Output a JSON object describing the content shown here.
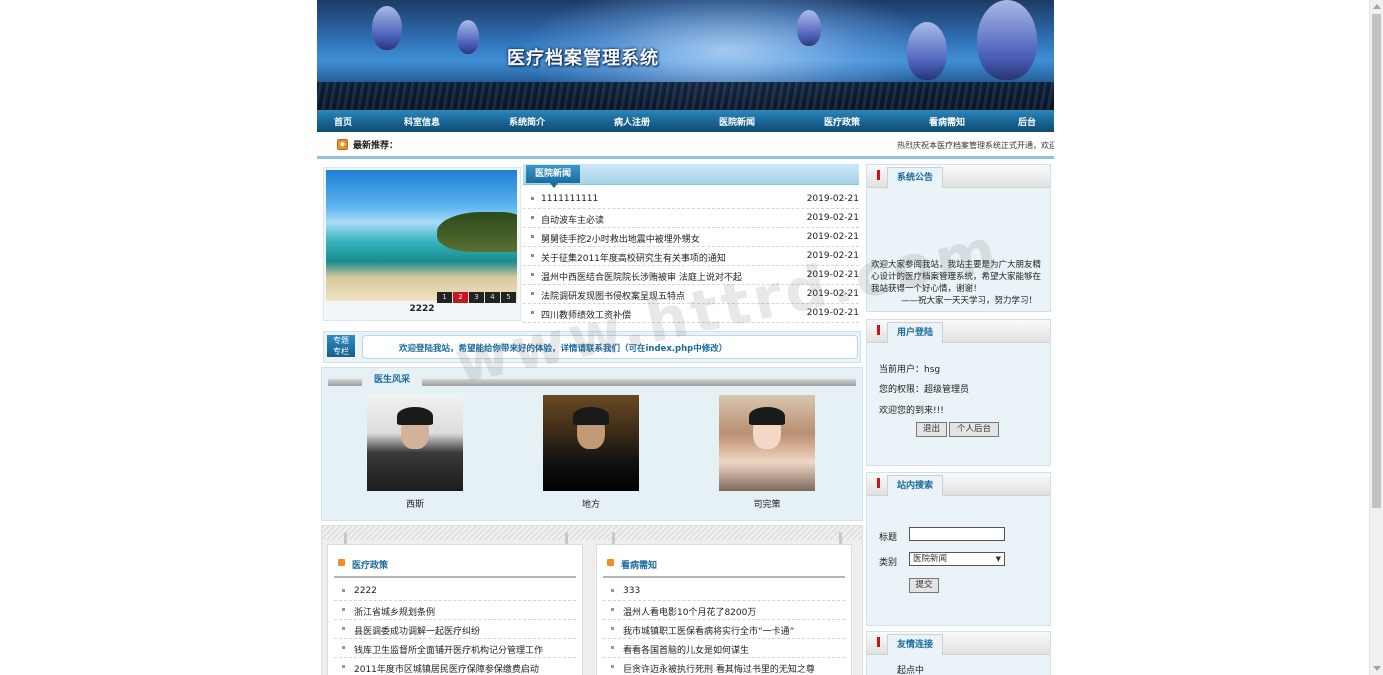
{
  "banner": {
    "title": "医疗档案管理系统"
  },
  "nav": {
    "items": [
      "首页",
      "科室信息",
      "系统简介",
      "病人注册",
      "医院新闻",
      "医疗政策",
      "看病需知",
      "后台"
    ]
  },
  "ticker": {
    "label": "最新推荐：",
    "text": "热烈庆祝本医疗档案管理系统正式开通，欢迎"
  },
  "slideshow": {
    "caption": "2222",
    "pages": [
      "1",
      "2",
      "3",
      "4",
      "5"
    ],
    "active_page": 2
  },
  "hospital_news": {
    "title": "医院新闻",
    "items": [
      {
        "title": "1111111111",
        "date": "2019-02-21"
      },
      {
        "title": "自动波车主必读",
        "date": "2019-02-21"
      },
      {
        "title": "舅舅徒手挖2小时救出地震中被埋外甥女",
        "date": "2019-02-21"
      },
      {
        "title": "关于征集2011年度高校研究生有关事项的通知",
        "date": "2019-02-21"
      },
      {
        "title": "温州中西医结合医院院长涉贿被审 法庭上说对不起",
        "date": "2019-02-21"
      },
      {
        "title": "法院调研发现图书侵权案呈现五特点",
        "date": "2019-02-21"
      },
      {
        "title": "四川教师绩效工资补偿",
        "date": "2019-02-21"
      }
    ]
  },
  "special": {
    "badge_line1": "专题",
    "badge_line2": "专栏",
    "message": "欢迎登陆我站，希望能给你带来好的体验，详情请联系我们（可在index.php中修改）"
  },
  "doctors": {
    "title": "医生风采",
    "list": [
      {
        "name": "西斯"
      },
      {
        "name": "地方"
      },
      {
        "name": "司完策"
      }
    ]
  },
  "policy": {
    "title": "医疗政策",
    "items": [
      "2222",
      "浙江省城乡规划条例",
      "县医调委成功调解一起医疗纠纷",
      "钱库卫生监督所全面铺开医疗机构记分管理工作",
      "2011年度市区城镇居民医疗保障参保缴费启动"
    ]
  },
  "notice_board": {
    "title": "看病需知",
    "items": [
      "333",
      "温州人看电影10个月花了8200万",
      "我市城镇职工医保看病将实行全市“一卡通”",
      "看看各国首脑的儿女是如何谋生",
      "巨贪许迈永被执行死刑 看其悔过书里的无知之尊"
    ]
  },
  "announcement": {
    "title": "系统公告",
    "text": "欢迎大家参阅我站，我站主要是为广大朋友精心设计的医疗档案管理系统，希望大家能够在我站获得一个好心情，谢谢！",
    "footer": "——祝大家一天天学习，努力学习！"
  },
  "login": {
    "title": "用户登陆",
    "current_user_label": "当前用户：",
    "current_user": "hsg",
    "role_label": "您的权限：",
    "role": "超级管理员",
    "welcome": "欢迎您的到来!!!",
    "logout_button": "退出",
    "profile_button": "个人后台"
  },
  "site_search": {
    "title": "站内搜索",
    "title_label": "标题",
    "title_value": "",
    "category_label": "类别",
    "category_selected": "医院新闻",
    "submit_label": "提交"
  },
  "links": {
    "title": "友情连接",
    "first": "起点中"
  },
  "watermark": "www.httrd.com",
  "colors": {
    "nav": "#17618f",
    "accent": "#1a6b9e",
    "highlight": "#c4161c",
    "icon_orange": "#ef8d2b"
  }
}
